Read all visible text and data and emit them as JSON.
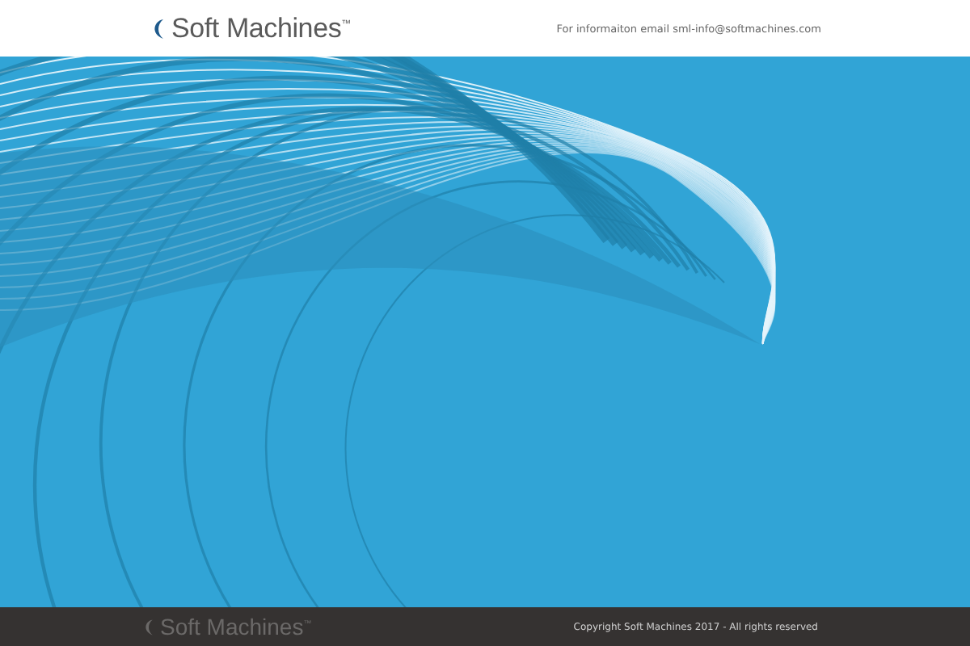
{
  "header": {
    "logo": "Soft Machines$^{™}$",
    "contact": "For informaiton email sml-info@softmachines.com"
  },
  "footer": {
    "logo": "Soft Machines$^{™}$",
    "copyright": "Copyright Soft Machines 2017 - All rights reserved"
  }
}
